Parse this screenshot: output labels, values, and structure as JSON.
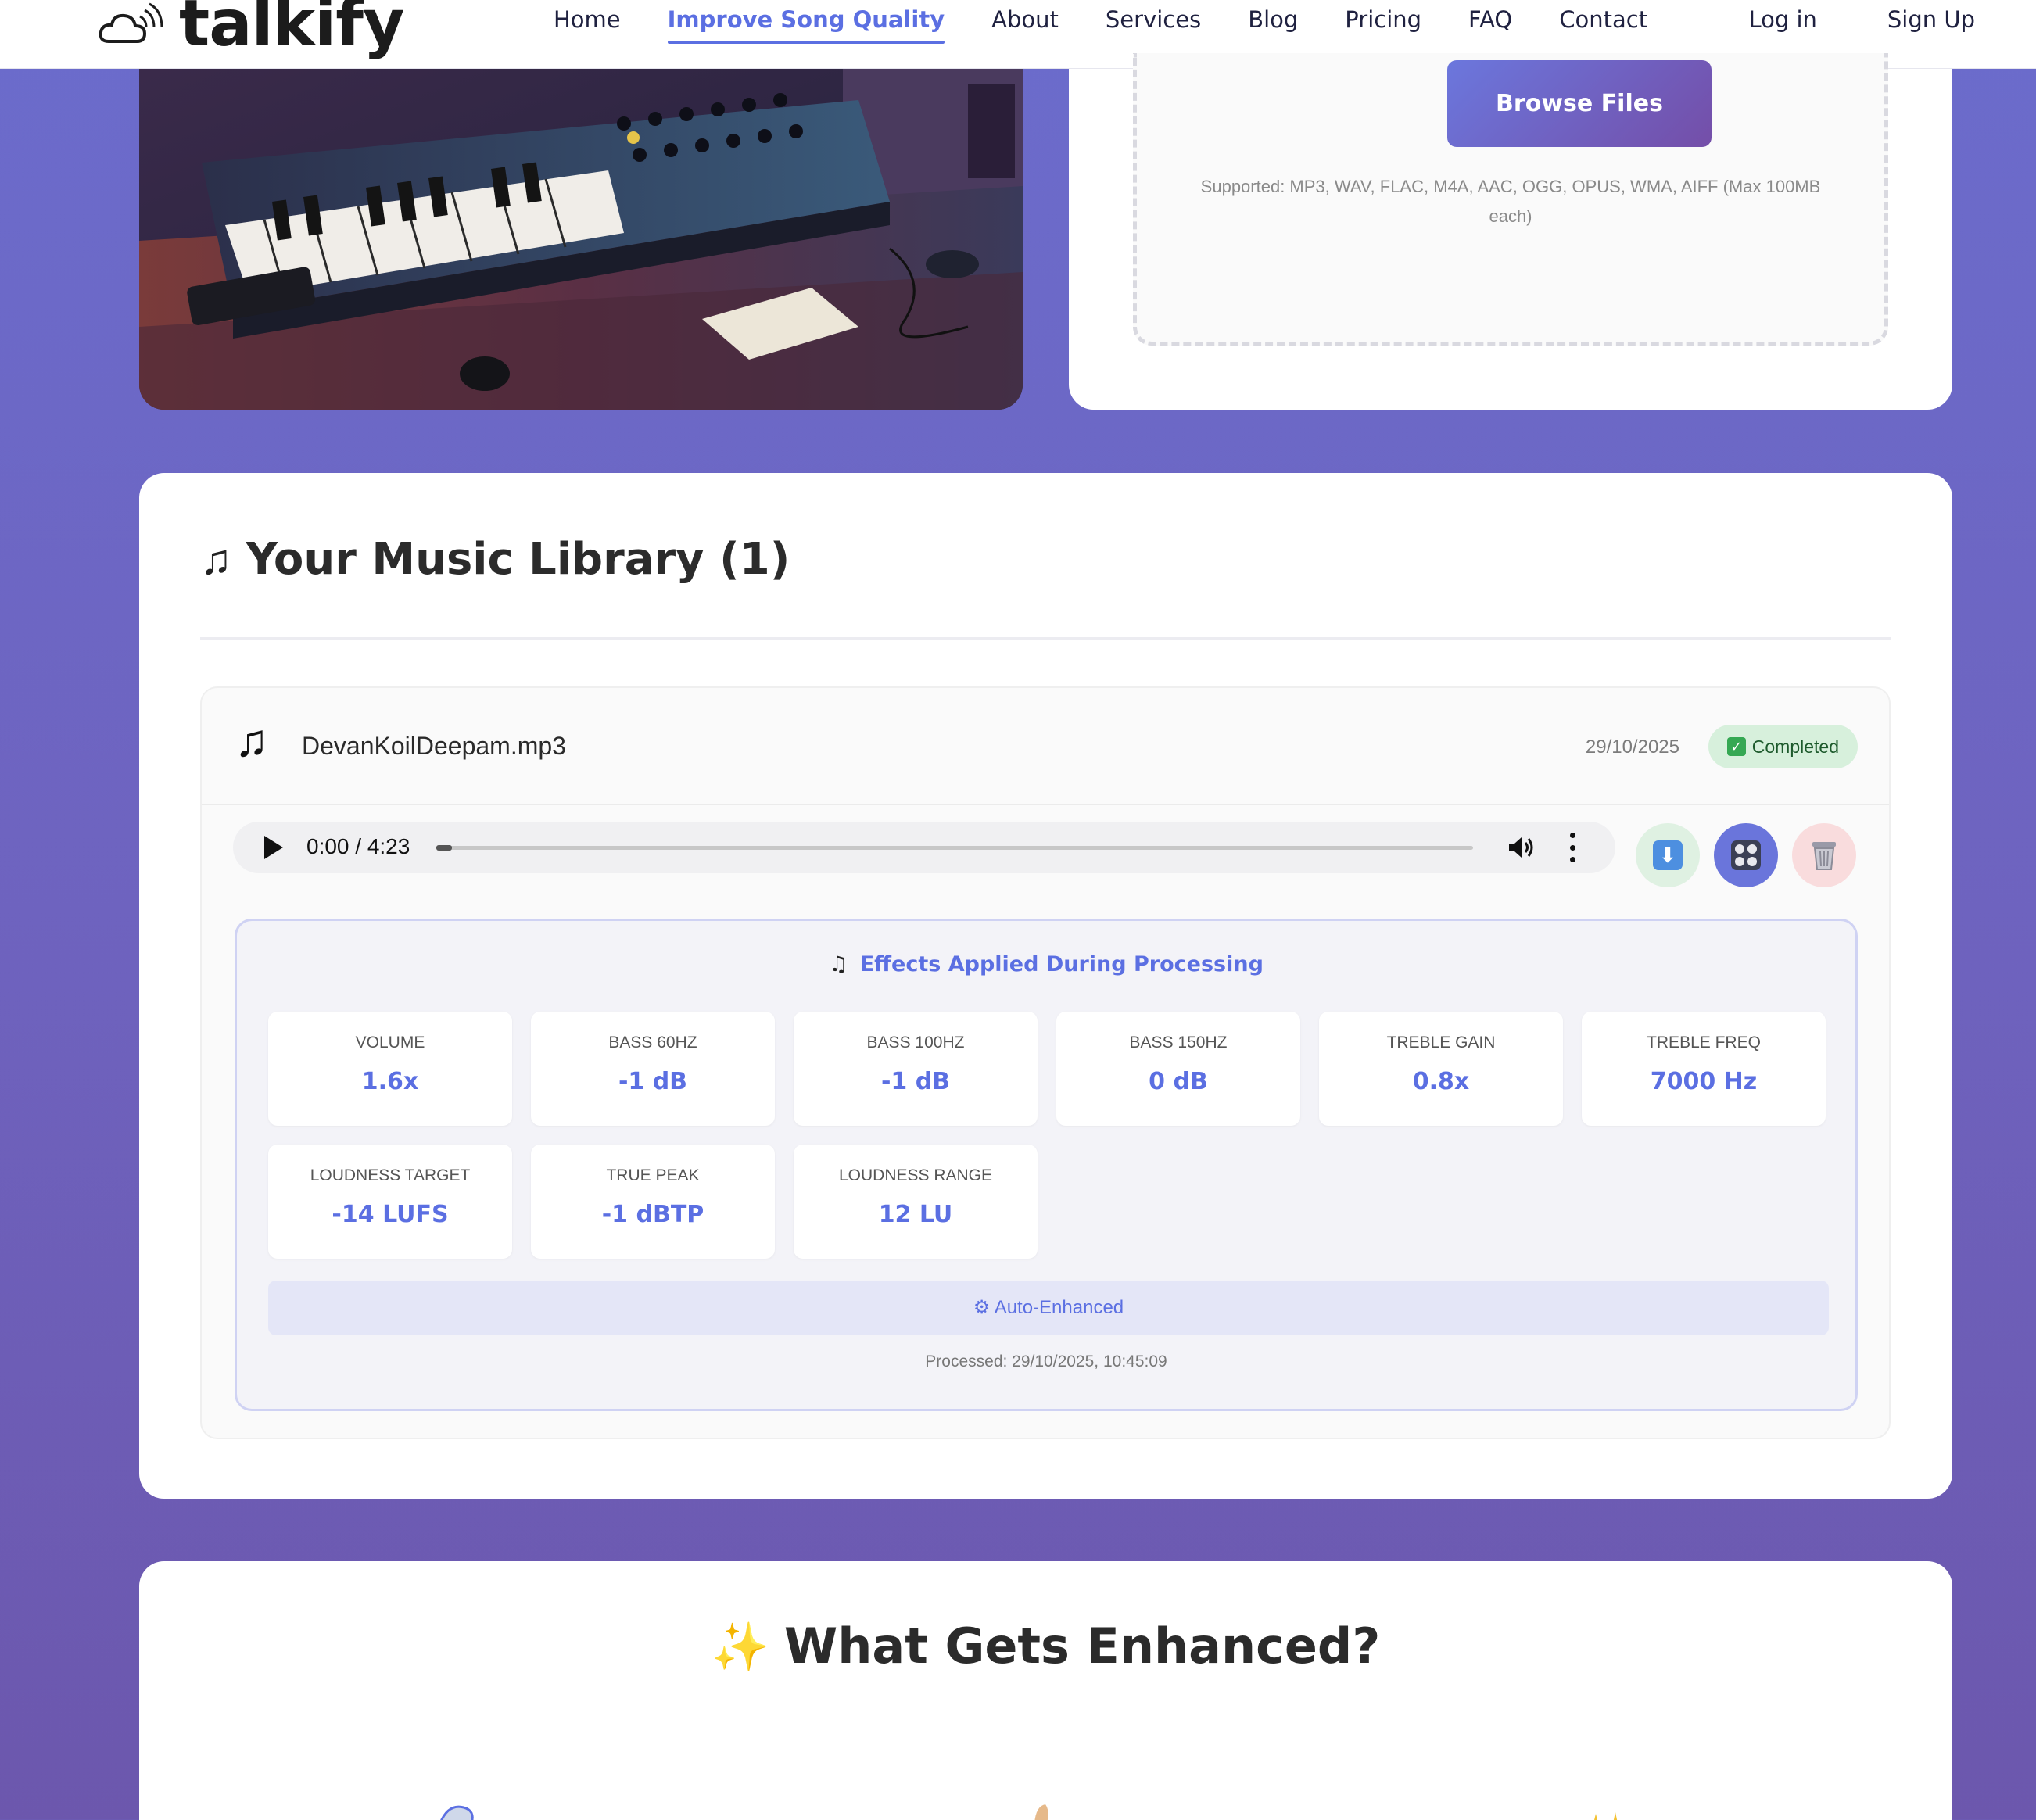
{
  "brand": {
    "name": "talkify"
  },
  "nav": {
    "items": [
      {
        "label": "Home"
      },
      {
        "label": "Improve Song Quality",
        "active": true
      },
      {
        "label": "About"
      },
      {
        "label": "Services"
      },
      {
        "label": "Blog"
      },
      {
        "label": "Pricing"
      },
      {
        "label": "FAQ"
      },
      {
        "label": "Contact"
      }
    ],
    "login": "Log in",
    "signup": "Sign Up"
  },
  "upload": {
    "browse_label": "Browse Files",
    "supported": "Supported: MP3, WAV, FLAC, M4A, AAC, OGG, OPUS, WMA, AIFF (Max 100MB each)"
  },
  "library": {
    "title": "Your Music Library (1)",
    "track": {
      "filename": "DevanKoilDeepam.mp3",
      "date": "29/10/2025",
      "status": "Completed",
      "player": {
        "time": "0:00 / 4:23",
        "progress_fraction": 0.0
      },
      "effects_title": "Effects Applied During Processing",
      "effects": [
        {
          "label": "Volume",
          "value": "1.6x"
        },
        {
          "label": "Bass 60Hz",
          "value": "-1 dB"
        },
        {
          "label": "Bass 100Hz",
          "value": "-1 dB"
        },
        {
          "label": "Bass 150Hz",
          "value": "0 dB"
        },
        {
          "label": "Treble Gain",
          "value": "0.8x"
        },
        {
          "label": "Treble Freq",
          "value": "7000 Hz"
        },
        {
          "label": "Loudness Target",
          "value": "-14 LUFS"
        },
        {
          "label": "True Peak",
          "value": "-1 dBTP"
        },
        {
          "label": "Loudness Range",
          "value": "12 LU"
        }
      ],
      "auto_enhanced": "Auto-Enhanced",
      "processed": "Processed: 29/10/2025, 10:45:09"
    }
  },
  "enhance": {
    "title": "What Gets Enhanced?"
  },
  "colors": {
    "accent": "#5b6fe2",
    "success_bg": "#d7f0dc",
    "danger_bg": "#f9dcdd"
  }
}
